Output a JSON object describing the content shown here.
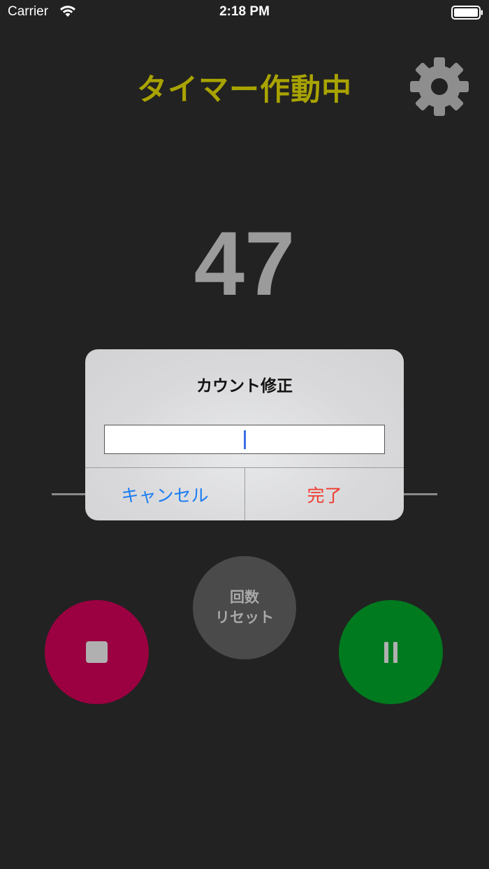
{
  "status_bar": {
    "carrier": "Carrier",
    "time": "2:18 PM"
  },
  "header": {
    "title": "タイマー作動中",
    "title_color": "#a9a300",
    "settings_icon": "gear-icon"
  },
  "timer": {
    "count": "47"
  },
  "controls": {
    "reset_count_line1": "回数",
    "reset_count_line2": "リセット",
    "stop_icon": "stop-icon",
    "stop_color": "#9b0040",
    "pause_icon": "pause-icon",
    "pause_color": "#007a1f"
  },
  "dialog": {
    "title": "カウント修正",
    "input_value": "",
    "cancel_label": "キャンセル",
    "done_label": "完了",
    "cancel_color": "#1a7cf2",
    "done_color": "#f03a2e"
  }
}
